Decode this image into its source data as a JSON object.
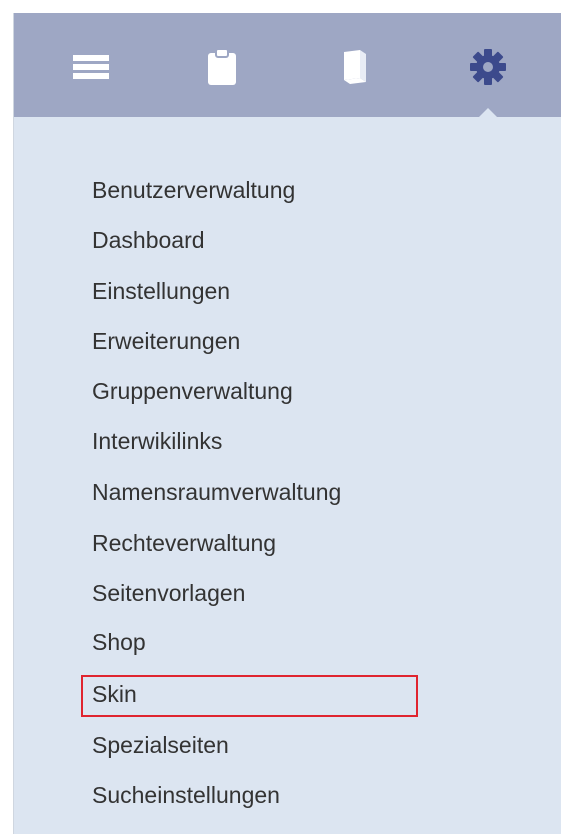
{
  "toolbar": {
    "icons": [
      "menu-lines-icon",
      "clipboard-icon",
      "book-icon",
      "gear-icon"
    ],
    "active": "gear-icon",
    "icon_color": "#ffffff",
    "active_icon_color": "#3c4a8c",
    "background": "#9ea7c4"
  },
  "menu": {
    "items": [
      "Benutzerverwaltung",
      "Dashboard",
      "Einstellungen",
      "Erweiterungen",
      "Gruppenverwaltung",
      "Interwikilinks",
      "Namensraumverwaltung",
      "Rechteverwaltung",
      "Seitenvorlagen",
      "Shop",
      "Skin",
      "Spezialseiten",
      "Sucheinstellungen"
    ],
    "highlighted": "Skin",
    "highlight_color": "#e0242f",
    "background": "#dce5f1"
  }
}
